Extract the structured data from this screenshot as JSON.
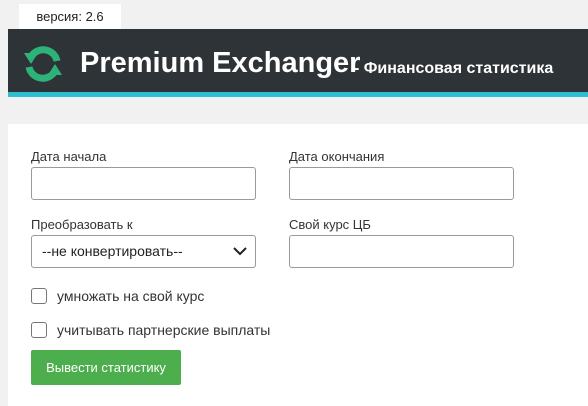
{
  "version_label": "версия: 2.6",
  "header": {
    "icon": "refresh-arrows-icon",
    "title": "Premium Exchanger",
    "subtitle": "- Финансовая статистика",
    "accent_color": "#2dbfcf",
    "logo_color": "#2db37a"
  },
  "form": {
    "start_date_label": "Дата начала",
    "start_date_value": "",
    "end_date_label": "Дата окончания",
    "end_date_value": "",
    "convert_label": "Преобразовать к",
    "convert_selected": "--не конвертировать--",
    "cb_rate_label": "Свой курс ЦБ",
    "cb_rate_value": "",
    "multiply_label": "умножать на свой курс",
    "multiply_checked": false,
    "partner_label": "учитывать партнерские выплаты",
    "partner_checked": false,
    "submit_label": "Вывести статистику",
    "submit_color": "#4cae4c"
  }
}
